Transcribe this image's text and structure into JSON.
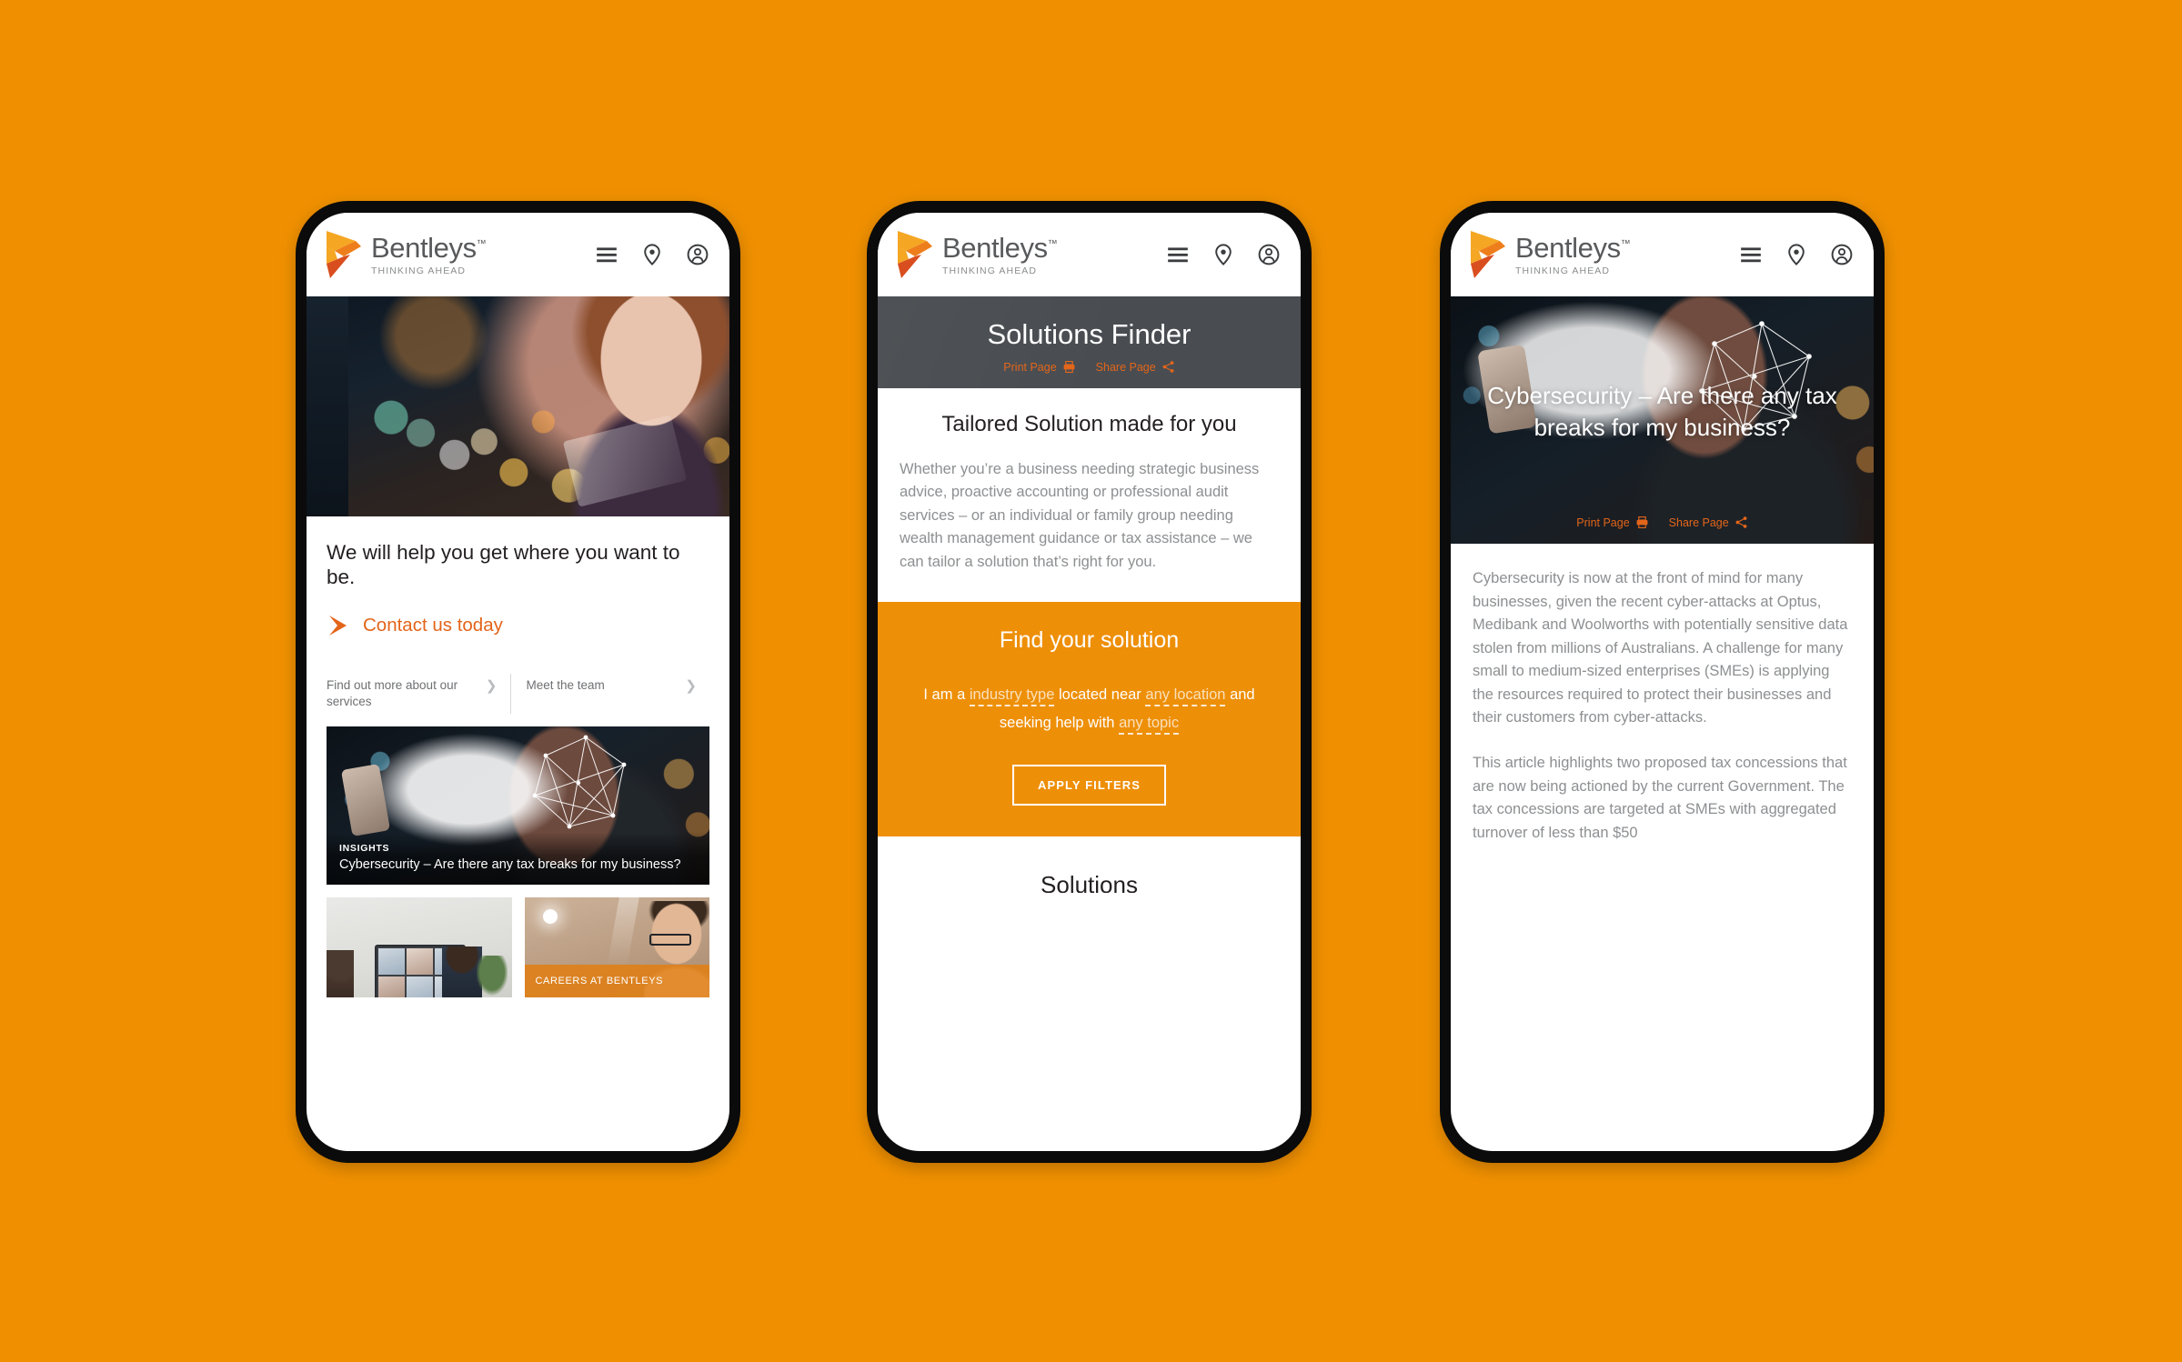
{
  "background_color": "#F09000",
  "brand": {
    "name": "Bentleys",
    "trademark": "™",
    "tagline": "THINKING AHEAD",
    "logo_icon": "bentleys-arrow-logo"
  },
  "header_icons": [
    {
      "name": "hamburger-menu-icon",
      "label": "Menu"
    },
    {
      "name": "location-pin-icon",
      "label": "Locations"
    },
    {
      "name": "user-account-icon",
      "label": "Account"
    }
  ],
  "colors": {
    "orange_accent": "#E3651A",
    "orange_panel": "#EE8F08",
    "dark_band": "#494D51",
    "body_text": "#8d8f91",
    "heading_text": "#231f20"
  },
  "phone1": {
    "hero_image": "woman-with-tablet-at-night-window",
    "headline": "We will help you get where you want to be.",
    "cta": {
      "label": "Contact us today",
      "icon": "orange-chevron-icon"
    },
    "quick_links": [
      {
        "label": "Find out more about our services",
        "icon": "chevron-right-icon"
      },
      {
        "label": "Meet the team",
        "icon": "chevron-right-icon"
      }
    ],
    "insights_card": {
      "image": "woman-facial-recognition-mesh",
      "kicker": "INSIGHTS",
      "title": "Cybersecurity – Are there any tax breaks for my business?"
    },
    "tiles": [
      {
        "image": "video-conference-meeting-room",
        "band_label": ""
      },
      {
        "image": "smiling-man-with-glasses-office",
        "band_label": "CAREERS AT BENTLEYS"
      }
    ]
  },
  "phone2": {
    "page_title": "Solutions Finder",
    "page_actions": [
      {
        "label": "Print Page",
        "icon": "printer-icon"
      },
      {
        "label": "Share Page",
        "icon": "share-icon"
      }
    ],
    "section_title": "Tailored Solution made for you",
    "section_body": "Whether you’re a business needing strategic business advice, proactive accounting or professional audit services – or an individual or family group needing wealth management guidance or tax assistance – we can tailor a solution that’s right for you.",
    "finder": {
      "title": "Find your solution",
      "segments": [
        {
          "type": "text",
          "value": "I am a"
        },
        {
          "type": "slot",
          "value": "industry type"
        },
        {
          "type": "text",
          "value": "located near"
        },
        {
          "type": "slot",
          "value": "any location"
        },
        {
          "type": "text",
          "value": "and seeking help with"
        },
        {
          "type": "slot",
          "value": "any topic"
        }
      ],
      "apply_button": "APPLY FILTERS"
    },
    "cut_off_text": "Solutions"
  },
  "phone3": {
    "hero_image": "woman-facial-recognition-mesh",
    "hero_title": "Cybersecurity – Are there any tax breaks for my business?",
    "page_actions": [
      {
        "label": "Print Page",
        "icon": "printer-icon"
      },
      {
        "label": "Share Page",
        "icon": "share-icon"
      }
    ],
    "paragraphs": [
      "Cybersecurity is now at the front of mind for many businesses, given the recent cyber-attacks at Optus, Medibank and Woolworths with potentially sensitive data stolen from millions of Australians. A challenge for many small to medium-sized enterprises (SMEs) is applying the resources required to protect their businesses and their customers from cyber-attacks.",
      "This article highlights two proposed tax concessions that are now being actioned by the current Government. The tax concessions are targeted at SMEs with aggregated turnover of less than $50"
    ]
  }
}
